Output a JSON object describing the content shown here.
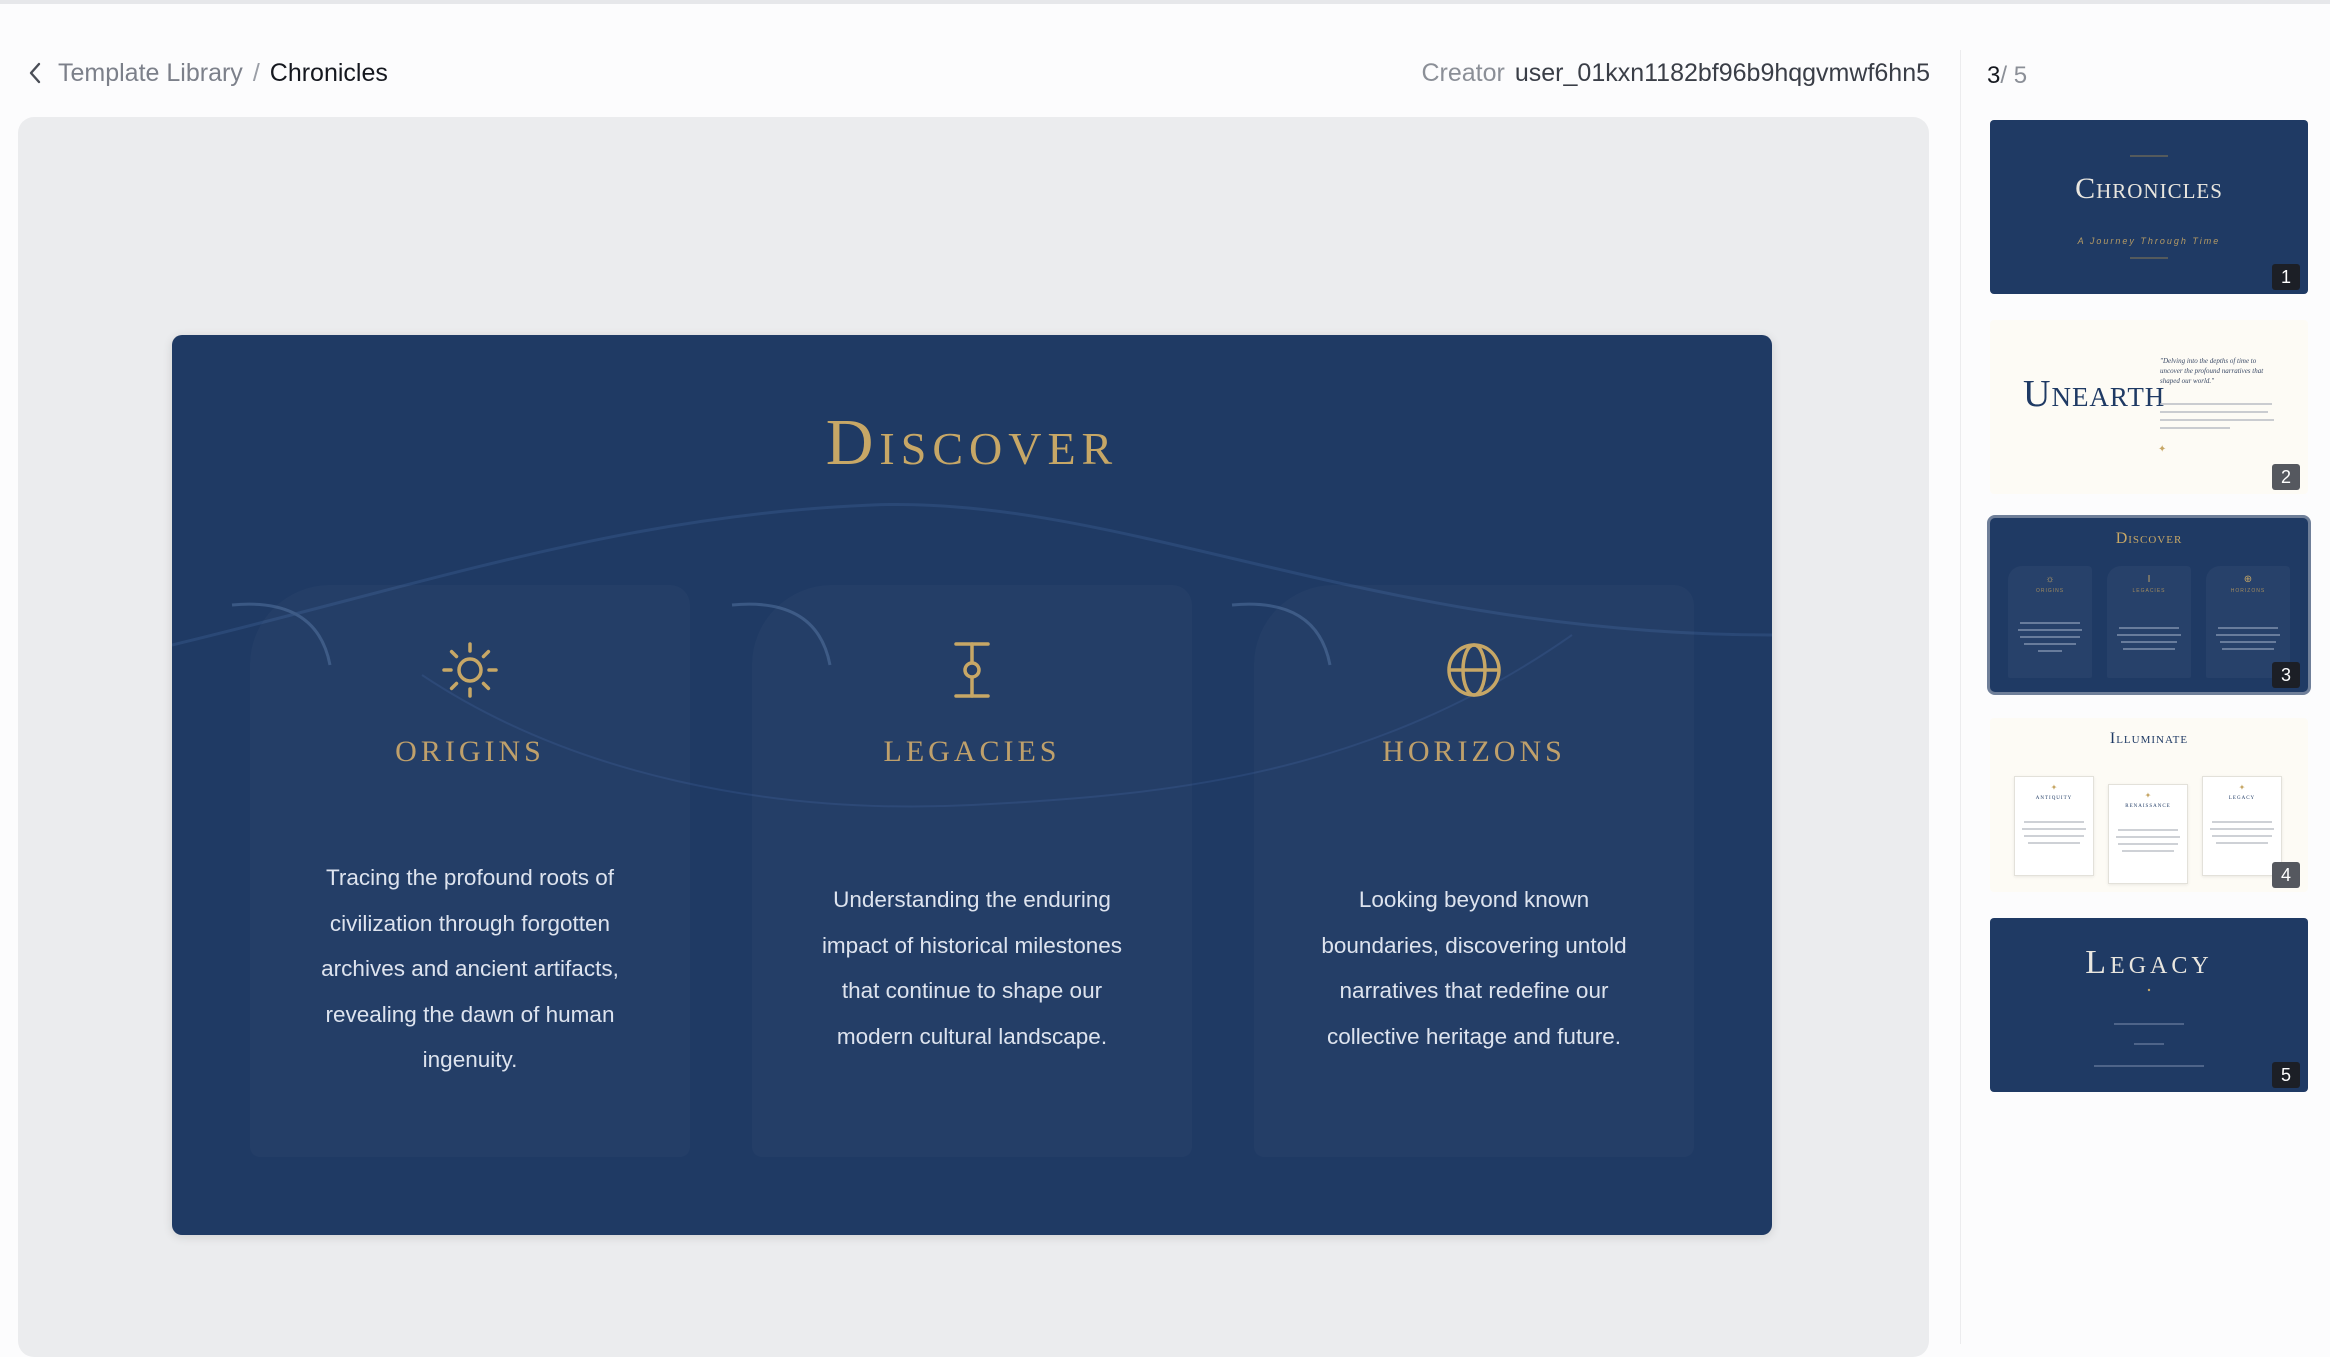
{
  "breadcrumb": {
    "parent": "Template Library",
    "separator": "/",
    "current": "Chronicles"
  },
  "creator": {
    "label": "Creator",
    "value": "user_01kxn1182bf96b9hqgvmwf6hn5"
  },
  "pager": {
    "current": "3",
    "total": "/ 5"
  },
  "colors": {
    "slide_bg": "#1f3a64",
    "gold": "#c7a766",
    "stage_bg": "#ebecee"
  },
  "slide": {
    "title": "Discover",
    "cards": [
      {
        "icon": "sun-icon",
        "title": "ORIGINS",
        "text": "Tracing the profound roots of civilization through forgotten archives and ancient artifacts, revealing the dawn of human ingenuity."
      },
      {
        "icon": "hourglass-icon",
        "title": "LEGACIES",
        "text": "Understanding the enduring impact of historical milestones that continue to shape our modern cultural landscape."
      },
      {
        "icon": "globe-icon",
        "title": "HORIZONS",
        "text": "Looking beyond known boundaries, discovering untold narratives that redefine our collective heritage and future."
      }
    ]
  },
  "thumbnails": [
    {
      "number": "1",
      "title": "Chronicles",
      "subtitle": "A Journey Through Time"
    },
    {
      "number": "2",
      "title": "Unearth",
      "quote": "\"Delving into the depths of time to uncover the profound narratives that shaped our world.\""
    },
    {
      "number": "3",
      "title": "Discover",
      "cards": [
        "ORIGINS",
        "LEGACIES",
        "HORIZONS"
      ]
    },
    {
      "number": "4",
      "title": "Illuminate",
      "cards": [
        "ANTIQUITY",
        "RENAISSANCE",
        "LEGACY"
      ]
    },
    {
      "number": "5",
      "title": "Legacy"
    }
  ]
}
